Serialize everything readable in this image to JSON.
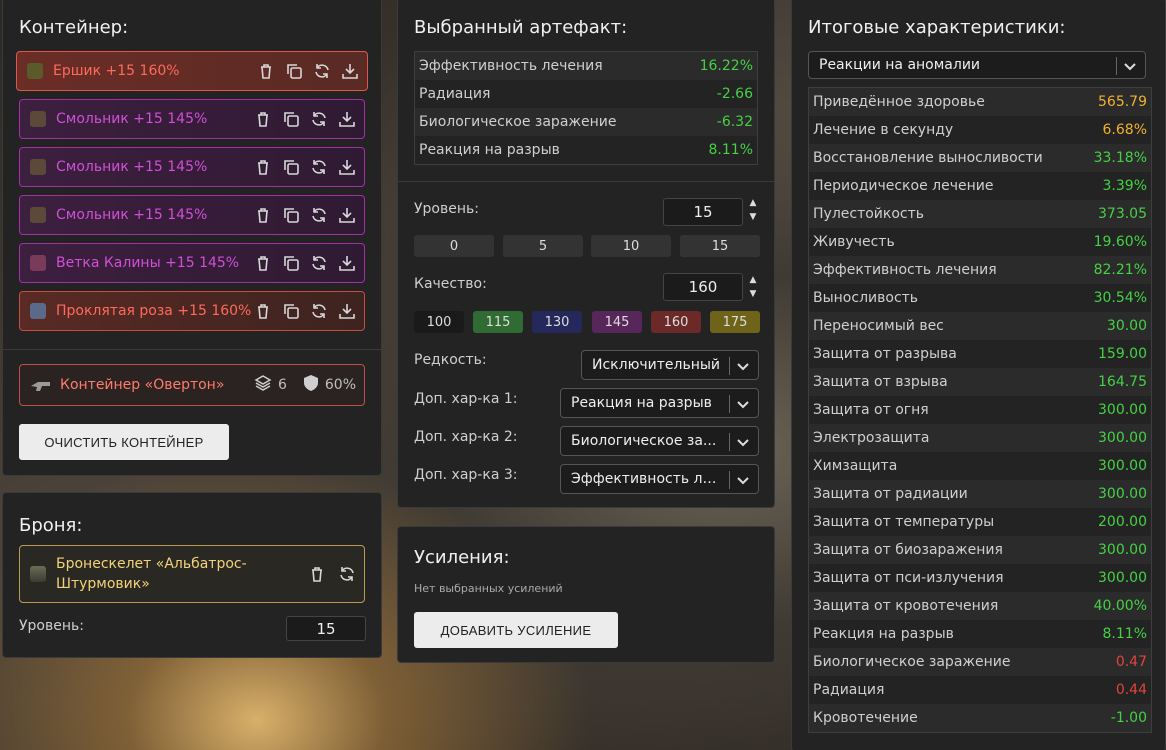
{
  "container": {
    "title": "Контейнер:",
    "artifacts": [
      {
        "name": "Ершик +15 160%",
        "color": "red",
        "selected": true,
        "icon": "urchin-icon"
      },
      {
        "name": "Смольник +15 145%",
        "color": "purple",
        "icon": "resin-icon"
      },
      {
        "name": "Смольник +15 145%",
        "color": "purple",
        "icon": "resin-icon"
      },
      {
        "name": "Смольник +15 145%",
        "color": "purple",
        "icon": "resin-icon"
      },
      {
        "name": "Ветка Калины +15 145%",
        "color": "purple",
        "icon": "branch-icon"
      },
      {
        "name": "Проклятая роза +15 160%",
        "color": "red",
        "icon": "rose-icon"
      }
    ],
    "container_item": {
      "name": "Контейнер «Овертон»",
      "slots": "6",
      "protection": "60%"
    },
    "clear_button": "ОЧИСТИТЬ КОНТЕЙНЕР"
  },
  "armor": {
    "title": "Броня:",
    "name": "Бронескелет «Альбатрос-Штурмовик»",
    "level_label": "Уровень:",
    "level_value": "15"
  },
  "artifact": {
    "title": "Выбранный артефакт:",
    "stats": [
      {
        "label": "Эффективность лечения",
        "value": "16.22%"
      },
      {
        "label": "Радиация",
        "value": "-2.66"
      },
      {
        "label": "Биологическое заражение",
        "value": "-6.32"
      },
      {
        "label": "Реакция на разрыв",
        "value": "8.11%"
      }
    ],
    "level_label": "Уровень:",
    "level_value": "15",
    "level_presets": [
      "0",
      "5",
      "10",
      "15"
    ],
    "quality_label": "Качество:",
    "quality_value": "160",
    "quality_presets": [
      {
        "label": "100",
        "color": "#1a1a1a"
      },
      {
        "label": "115",
        "color": "#2f6b32"
      },
      {
        "label": "130",
        "color": "#25285a"
      },
      {
        "label": "145",
        "color": "#57275c"
      },
      {
        "label": "160",
        "color": "#6b2a28"
      },
      {
        "label": "175",
        "color": "#6f6319"
      }
    ],
    "rarity_label": "Редкость:",
    "rarity_value": "Исключительный",
    "extra1_label": "Доп. хар-ка 1:",
    "extra1_value": "Реакция на разрыв",
    "extra2_label": "Доп. хар-ка 2:",
    "extra2_value": "Биологическое за...",
    "extra3_label": "Доп. хар-ка 3:",
    "extra3_value": "Эффективность ле..."
  },
  "boosts": {
    "title": "Усиления:",
    "empty_text": "Нет выбранных усилений",
    "add_button": "ДОБАВИТЬ УСИЛЕНИЕ"
  },
  "totals": {
    "title": "Итоговые характеристики:",
    "filter_value": "Реакции на аномалии",
    "stats": [
      {
        "label": "Приведённое здоровье",
        "value": "565.79",
        "tone": "orange"
      },
      {
        "label": "Лечение в секунду",
        "value": "6.68%",
        "tone": "orange"
      },
      {
        "label": "Восстановление выносливости",
        "value": "33.18%",
        "tone": "green"
      },
      {
        "label": "Периодическое лечение",
        "value": "3.39%",
        "tone": "green"
      },
      {
        "label": "Пулестойкость",
        "value": "373.05",
        "tone": "green"
      },
      {
        "label": "Живучесть",
        "value": "19.60%",
        "tone": "green"
      },
      {
        "label": "Эффективность лечения",
        "value": "82.21%",
        "tone": "green"
      },
      {
        "label": "Выносливость",
        "value": "30.54%",
        "tone": "green"
      },
      {
        "label": "Переносимый вес",
        "value": "30.00",
        "tone": "green"
      },
      {
        "label": "Защита от разрыва",
        "value": "159.00",
        "tone": "green"
      },
      {
        "label": "Защита от взрыва",
        "value": "164.75",
        "tone": "green"
      },
      {
        "label": "Защита от огня",
        "value": "300.00",
        "tone": "green"
      },
      {
        "label": "Электрозащита",
        "value": "300.00",
        "tone": "green"
      },
      {
        "label": "Химзащита",
        "value": "300.00",
        "tone": "green"
      },
      {
        "label": "Защита от радиации",
        "value": "300.00",
        "tone": "green"
      },
      {
        "label": "Защита от температуры",
        "value": "200.00",
        "tone": "green"
      },
      {
        "label": "Защита от биозаражения",
        "value": "300.00",
        "tone": "green"
      },
      {
        "label": "Защита от пси-излучения",
        "value": "300.00",
        "tone": "green"
      },
      {
        "label": "Защита от кровотечения",
        "value": "40.00%",
        "tone": "green"
      },
      {
        "label": "Реакция на разрыв",
        "value": "8.11%",
        "tone": "green"
      },
      {
        "label": "Биологическое заражение",
        "value": "0.47",
        "tone": "red"
      },
      {
        "label": "Радиация",
        "value": "0.44",
        "tone": "red"
      },
      {
        "label": "Кровотечение",
        "value": "-1.00",
        "tone": "green"
      }
    ]
  }
}
